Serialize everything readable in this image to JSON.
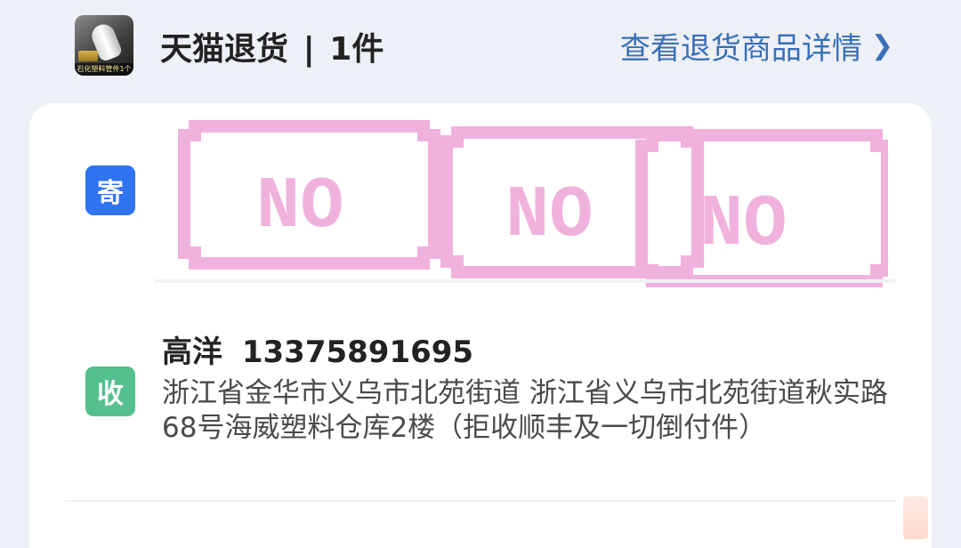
{
  "header": {
    "title": "天猫退货",
    "count": "1件",
    "details_link": "查看退货商品详情",
    "thumb_caption": "石化塑料管件1个"
  },
  "sender": {
    "badge": "寄",
    "stamp_text": "NO"
  },
  "receiver": {
    "badge": "收",
    "name": "高洋",
    "phone": "13375891695",
    "address": "浙江省金华市义乌市北苑街道 浙江省义乌市北苑街道秋实路68号海威塑料仓库2楼（拒收顺丰及一切倒付件）"
  },
  "colors": {
    "send_badge": "#2f73f2",
    "recv_badge": "#55c08e",
    "link": "#3a6fb8",
    "stamp": "#f0b2dd"
  },
  "icons": {
    "details_chevron": "chevron-right-icon"
  }
}
